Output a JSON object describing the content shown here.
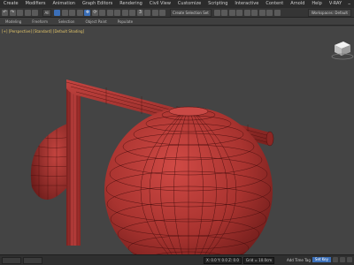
{
  "menus": [
    "Create",
    "Modifiers",
    "Animation",
    "Graph Editors",
    "Rendering",
    "Civil View",
    "Customize",
    "Scripting",
    "Interactive",
    "Content",
    "Arnold",
    "Help",
    "V-RAY"
  ],
  "toolbar": {
    "selection_filter": "All",
    "named_selection_placeholder": "Create Selection Set",
    "workspace": "Workspaces: Default"
  },
  "ribbon_tabs": [
    "Modeling",
    "Freeform",
    "Selection",
    "Object Paint",
    "Populate"
  ],
  "viewport": {
    "label": "[+] [Perspective] [Standard] [Default Shading]",
    "object_color": "#b03a37",
    "wire_color": "#4a0f0e"
  },
  "status": {
    "coords": "X: 0.0   Y: 0.0   Z: 0.0",
    "grid": "Grid = 10.0cm",
    "add_time_tag": "Add Time Tag",
    "set_key": "Set Key"
  }
}
